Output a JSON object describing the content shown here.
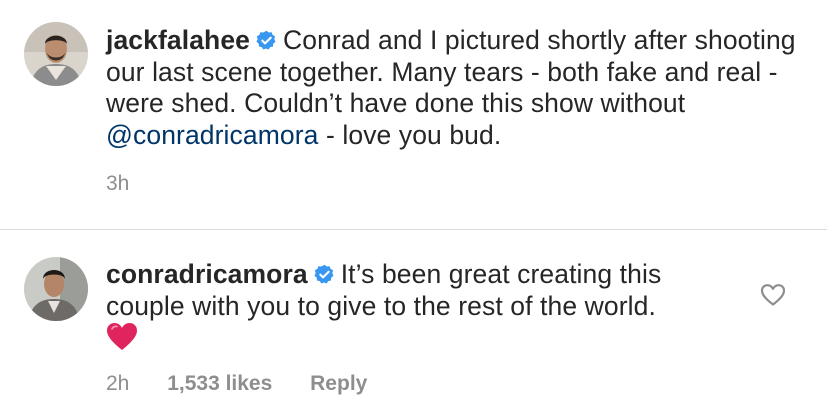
{
  "comments": [
    {
      "username": "jackfalahee",
      "text_before": "Conrad and I pictured shortly after shooting our last scene together. Many tears - both fake and real - were shed. Couldn’t have done this show without ",
      "mention": "@conradricamora",
      "text_after": " - love you bud.",
      "time": "3h"
    },
    {
      "username": "conradricamora",
      "text": "It’s been great creating this couple with you to give to the rest of the world.",
      "emoji": "red-heart-emoji",
      "time": "2h",
      "likes": "1,533 likes",
      "reply_label": "Reply"
    }
  ],
  "colors": {
    "text": "#262626",
    "muted": "#8e8e8e",
    "mention": "#003569",
    "verified": "#3897f0",
    "heart": "#e0245e"
  }
}
